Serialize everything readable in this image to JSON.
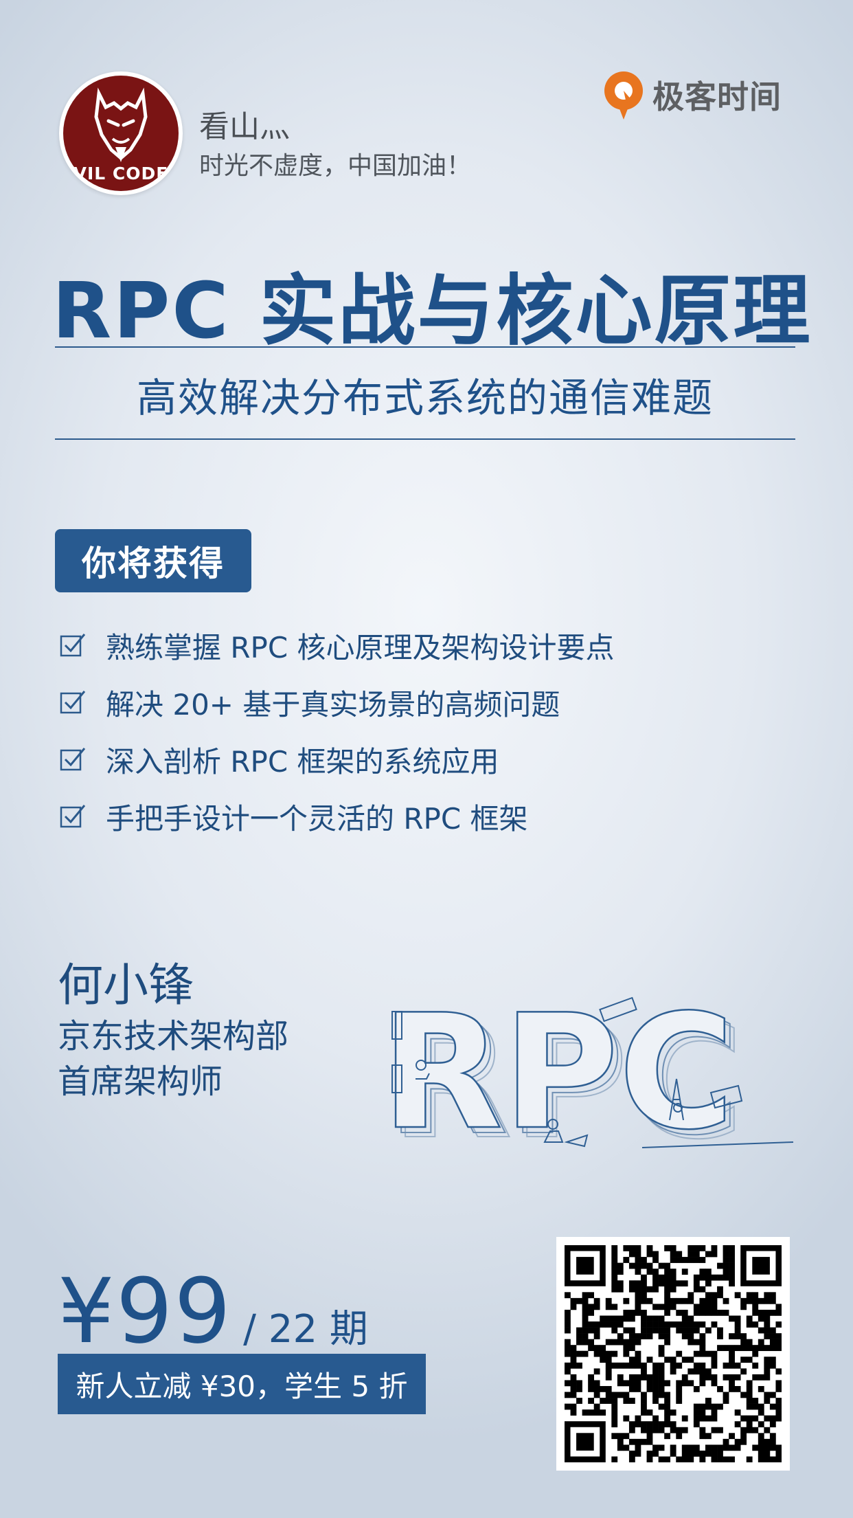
{
  "profile": {
    "avatar_text": "VIL CODE",
    "name": "看山灬",
    "motto": "时光不虚度，中国加油！"
  },
  "brand": {
    "name": "极客时间",
    "icon": "geekbang-logo-icon",
    "color": "#e8751f"
  },
  "course": {
    "title": "RPC 实战与核心原理",
    "subtitle": "高效解决分布式系统的通信难题"
  },
  "gains": {
    "heading": "你将获得",
    "items": [
      "熟练掌握 RPC 核心原理及架构设计要点",
      "解决 20+ 基于真实场景的高频问题",
      "深入剖析 RPC 框架的系统应用",
      "手把手设计一个灵活的 RPC 框架"
    ]
  },
  "author": {
    "name": "何小锋",
    "department": "京东技术架构部",
    "role": "首席架构师"
  },
  "illustration": {
    "text": "RPC"
  },
  "pricing": {
    "price": "¥99",
    "period": "/ 22 期",
    "promo": "新人立减 ¥30，学生 5 折"
  },
  "colors": {
    "primary": "#1f5189",
    "badge": "#285a90",
    "avatar_bg": "#7a1414"
  }
}
